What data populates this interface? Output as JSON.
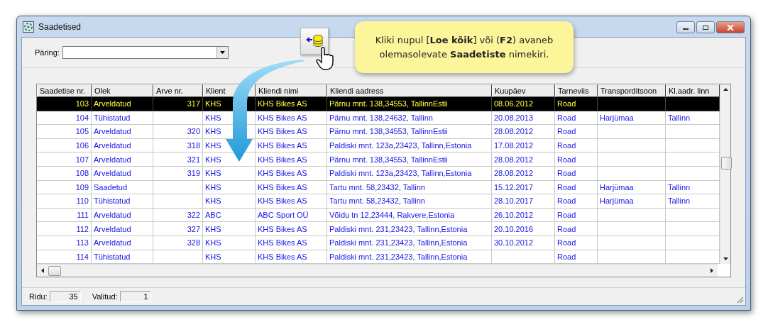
{
  "window": {
    "title": "Saadetised"
  },
  "query": {
    "label": "Päring:"
  },
  "callout": {
    "text": "Kliki nupul [**Loe kõik**] või (**F2**) avaneb olemasolevate **Saadetiste** nimekiri."
  },
  "table": {
    "columns": [
      "Saadetise nr.",
      "Olek",
      "Arve nr.",
      "Klient",
      "Kliendi nimi",
      "Kliendi aadress",
      "Kuupäev",
      "Tarneviis",
      "Transporditsoon",
      "Kl.aadr. linn"
    ],
    "rows": [
      {
        "selected": true,
        "cells": [
          "103",
          "Arveldatud",
          "317",
          "KHS",
          "KHS Bikes AS",
          "Pärnu mnt. 138,34553, TallinnEstii",
          "08.06.2012",
          "Road",
          "",
          ""
        ]
      },
      {
        "selected": false,
        "cells": [
          "104",
          "Tühistatud",
          "",
          "KHS",
          "KHS Bikes AS",
          "Pärnu mnt. 138,24632, Tallinn",
          "20.08.2013",
          "Road",
          "Harjümaa",
          "Tallinn"
        ]
      },
      {
        "selected": false,
        "cells": [
          "105",
          "Arveldatud",
          "320",
          "KHS",
          "KHS Bikes AS",
          "Pärnu mnt. 138,34553, TallinnEstii",
          "28.08.2012",
          "Road",
          "",
          ""
        ]
      },
      {
        "selected": false,
        "cells": [
          "106",
          "Arveldatud",
          "318",
          "KHS",
          "KHS Bikes AS",
          "Paldiski mnt. 123a,23423, Tallinn,Estonia",
          "17.08.2012",
          "Road",
          "",
          ""
        ]
      },
      {
        "selected": false,
        "cells": [
          "107",
          "Arveldatud",
          "321",
          "KHS",
          "KHS Bikes AS",
          "Pärnu mnt. 138,34553, TallinnEstii",
          "28.08.2012",
          "Road",
          "",
          ""
        ]
      },
      {
        "selected": false,
        "cells": [
          "108",
          "Arveldatud",
          "319",
          "KHS",
          "KHS Bikes AS",
          "Paldiski mnt. 123a,23423, Tallinn,Estonia",
          "28.08.2012",
          "Road",
          "",
          ""
        ]
      },
      {
        "selected": false,
        "cells": [
          "109",
          "Saadetud",
          "",
          "KHS",
          "KHS Bikes AS",
          "Tartu mnt. 58,23432, Tallinn",
          "15.12.2017",
          "Road",
          "Harjümaa",
          "Tallinn"
        ]
      },
      {
        "selected": false,
        "cells": [
          "110",
          "Tühistatud",
          "",
          "KHS",
          "KHS Bikes AS",
          "Tartu mnt. 58,23432, Tallinn",
          "28.10.2017",
          "Road",
          "Harjümaa",
          "Tallinn"
        ]
      },
      {
        "selected": false,
        "cells": [
          "111",
          "Arveldatud",
          "322",
          "ABC",
          "ABC Sport OÜ",
          "Võidu tn 12,23444, Rakvere,Estonia",
          "26.10.2012",
          "Road",
          "",
          ""
        ]
      },
      {
        "selected": false,
        "cells": [
          "112",
          "Arveldatud",
          "327",
          "KHS",
          "KHS Bikes AS",
          "Paldiski mnt. 231,23423, Tallinn,Estonia",
          "20.10.2016",
          "Road",
          "",
          ""
        ]
      },
      {
        "selected": false,
        "cells": [
          "113",
          "Arveldatud",
          "328",
          "KHS",
          "KHS Bikes AS",
          "Paldiski mnt. 231,23423, Tallinn,Estonia",
          "30.10.2012",
          "Road",
          "",
          ""
        ]
      },
      {
        "selected": false,
        "cells": [
          "114",
          "Tühistatud",
          "",
          "KHS",
          "KHS Bikes AS",
          "Paldiski mnt. 231,23423, Tallinn,Estonia",
          "",
          "Road",
          "",
          ""
        ]
      }
    ]
  },
  "status_bar": {
    "rows_label": "Ridu:",
    "rows_value": "35",
    "selected_label": "Valitud:",
    "selected_value": "1"
  }
}
